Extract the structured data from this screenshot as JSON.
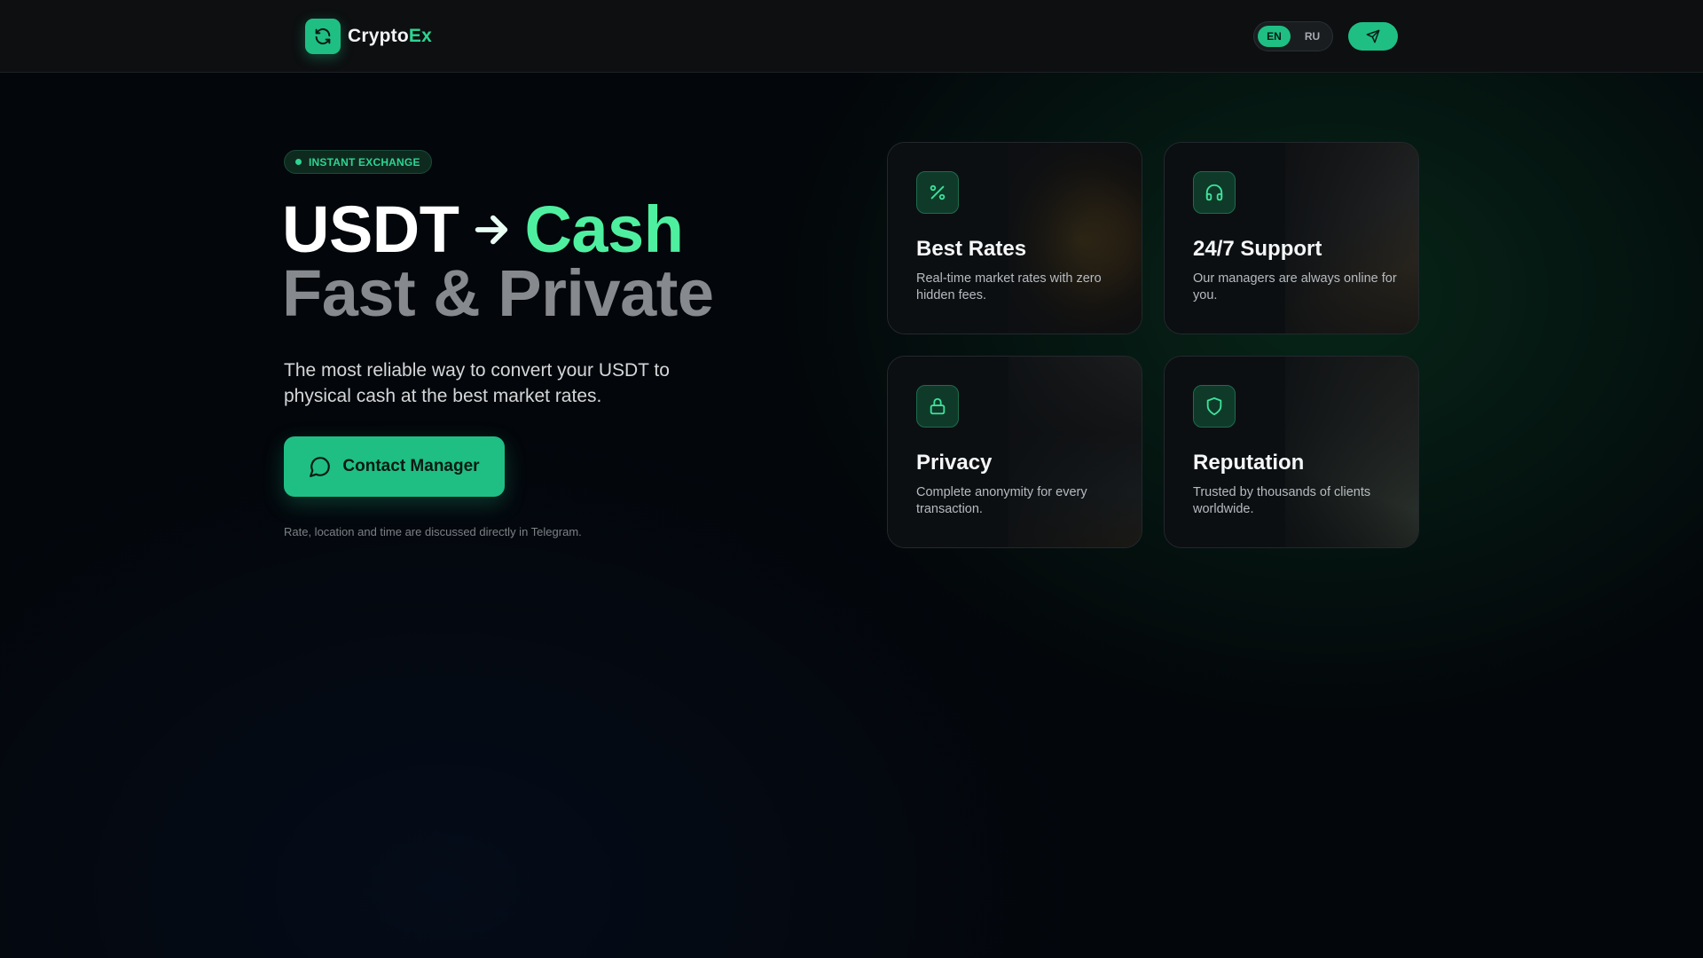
{
  "brand": {
    "name": "Crypto",
    "accent": "Ex"
  },
  "header": {
    "languages": [
      {
        "code": "EN",
        "active": true
      },
      {
        "code": "RU",
        "active": false
      }
    ],
    "telegram_icon": "send-icon"
  },
  "hero": {
    "badge": "INSTANT EXCHANGE",
    "title_from": "USDT",
    "title_to": "Cash",
    "title_line2": "Fast & Private",
    "description": "The most reliable way to convert your USDT to physical cash at the best market rates.",
    "cta_label": "Contact Manager",
    "note": "Rate, location and time are discussed directly in Telegram."
  },
  "features": [
    {
      "icon": "percent-icon",
      "title": "Best Rates",
      "description": "Real-time market rates with zero hidden fees."
    },
    {
      "icon": "headphones-icon",
      "title": "24/7 Support",
      "description": "Our managers are always online for you."
    },
    {
      "icon": "lock-icon",
      "title": "Privacy",
      "description": "Complete anonymity for every transaction."
    },
    {
      "icon": "shield-icon",
      "title": "Reputation",
      "description": "Trusted by thousands of clients worldwide."
    }
  ],
  "colors": {
    "accent": "#1fbf84",
    "accent_light": "#4ef0a0",
    "background": "#03060a"
  }
}
